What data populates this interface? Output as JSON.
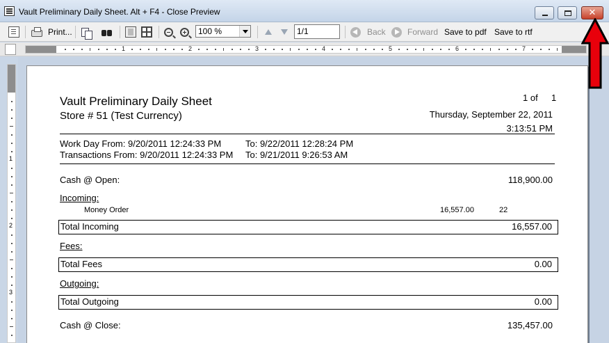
{
  "window": {
    "title": "Vault Preliminary Daily Sheet.   Alt + F4 - Close Preview",
    "close_glyph": "✕"
  },
  "toolbar": {
    "print_label": "Print...",
    "zoom_value": "100 %",
    "page_value": "1/1",
    "back_label": "Back",
    "forward_label": "Forward",
    "save_pdf_label": "Save to pdf",
    "save_rtf_label": "Save to rtf"
  },
  "ruler": {
    "h_numbers": [
      "1",
      "2",
      "3",
      "4",
      "5",
      "6",
      "7"
    ],
    "v_numbers": [
      "1",
      "2",
      "3"
    ]
  },
  "report": {
    "title": "Vault Preliminary Daily Sheet",
    "store": "Store # 51 (Test Currency)",
    "page_of": "1  of",
    "page_total": "1",
    "date": "Thursday, September 22, 2011",
    "time": "3:13:51 PM",
    "workday_from": "Work Day From: 9/20/2011 12:24:33 PM",
    "workday_to": "To: 9/22/2011 12:28:24 PM",
    "transactions_from": "Transactions From: 9/20/2011 12:24:33 PM",
    "transactions_to": "To: 9/21/2011 9:26:53 AM",
    "cash_open_label": "Cash @ Open:",
    "cash_open_value": "118,900.00",
    "incoming_label": "Incoming:",
    "incoming_items": [
      {
        "name": "Money Order",
        "amount": "16,557.00",
        "count": "22"
      }
    ],
    "total_incoming_label": "Total Incoming",
    "total_incoming_value": "16,557.00",
    "fees_label": "Fees:",
    "total_fees_label": "Total Fees",
    "total_fees_value": "0.00",
    "outgoing_label": "Outgoing:",
    "total_outgoing_label": "Total Outgoing",
    "total_outgoing_value": "0.00",
    "cash_close_label": "Cash @ Close:",
    "cash_close_value": "135,457.00"
  },
  "colors": {
    "annotation_arrow": "#e8000b",
    "close_button": "#c7412a"
  }
}
